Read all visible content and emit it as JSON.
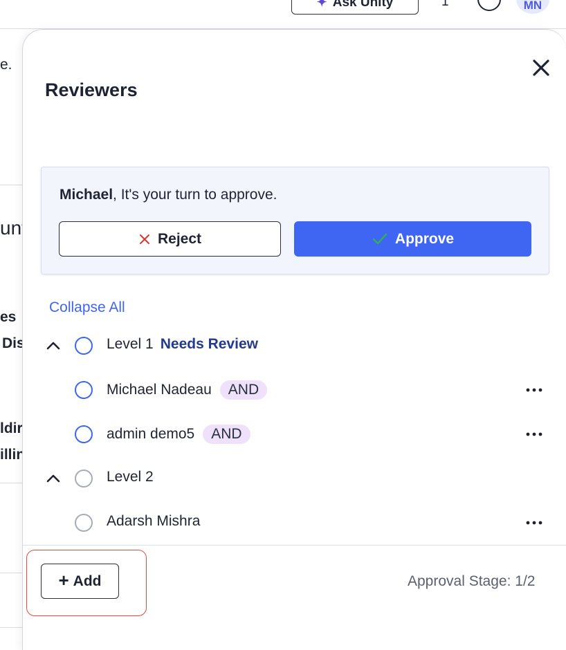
{
  "topbar": {
    "ask_label": "Ask Unity",
    "count": "1",
    "avatar_initials": "MN"
  },
  "background_fragments": [
    "e.",
    "unt",
    "es",
    "Dis",
    "ldir",
    "illin"
  ],
  "drawer": {
    "title": "Reviewers",
    "approval": {
      "user_name": "Michael",
      "message": ", It's your turn to approve.",
      "reject_label": "Reject",
      "approve_label": "Approve"
    },
    "collapse_all_label": "Collapse All",
    "levels": [
      {
        "label": "Level 1",
        "status": "Needs Review",
        "reviewers": [
          {
            "name": "Michael Nadeau",
            "tag": "AND"
          },
          {
            "name": "admin demo5",
            "tag": "AND"
          }
        ]
      },
      {
        "label": "Level 2",
        "status": "",
        "reviewers": [
          {
            "name": "Adarsh Mishra",
            "tag": ""
          }
        ]
      }
    ],
    "footer": {
      "add_label": "Add",
      "approval_stage": "Approval Stage: 1/2"
    }
  },
  "colors": {
    "primary": "#3f65f3",
    "status_text": "#233a8e",
    "tag_bg": "#efe1fb",
    "reject_icon": "#e0342e",
    "highlight": "#e24a40"
  }
}
